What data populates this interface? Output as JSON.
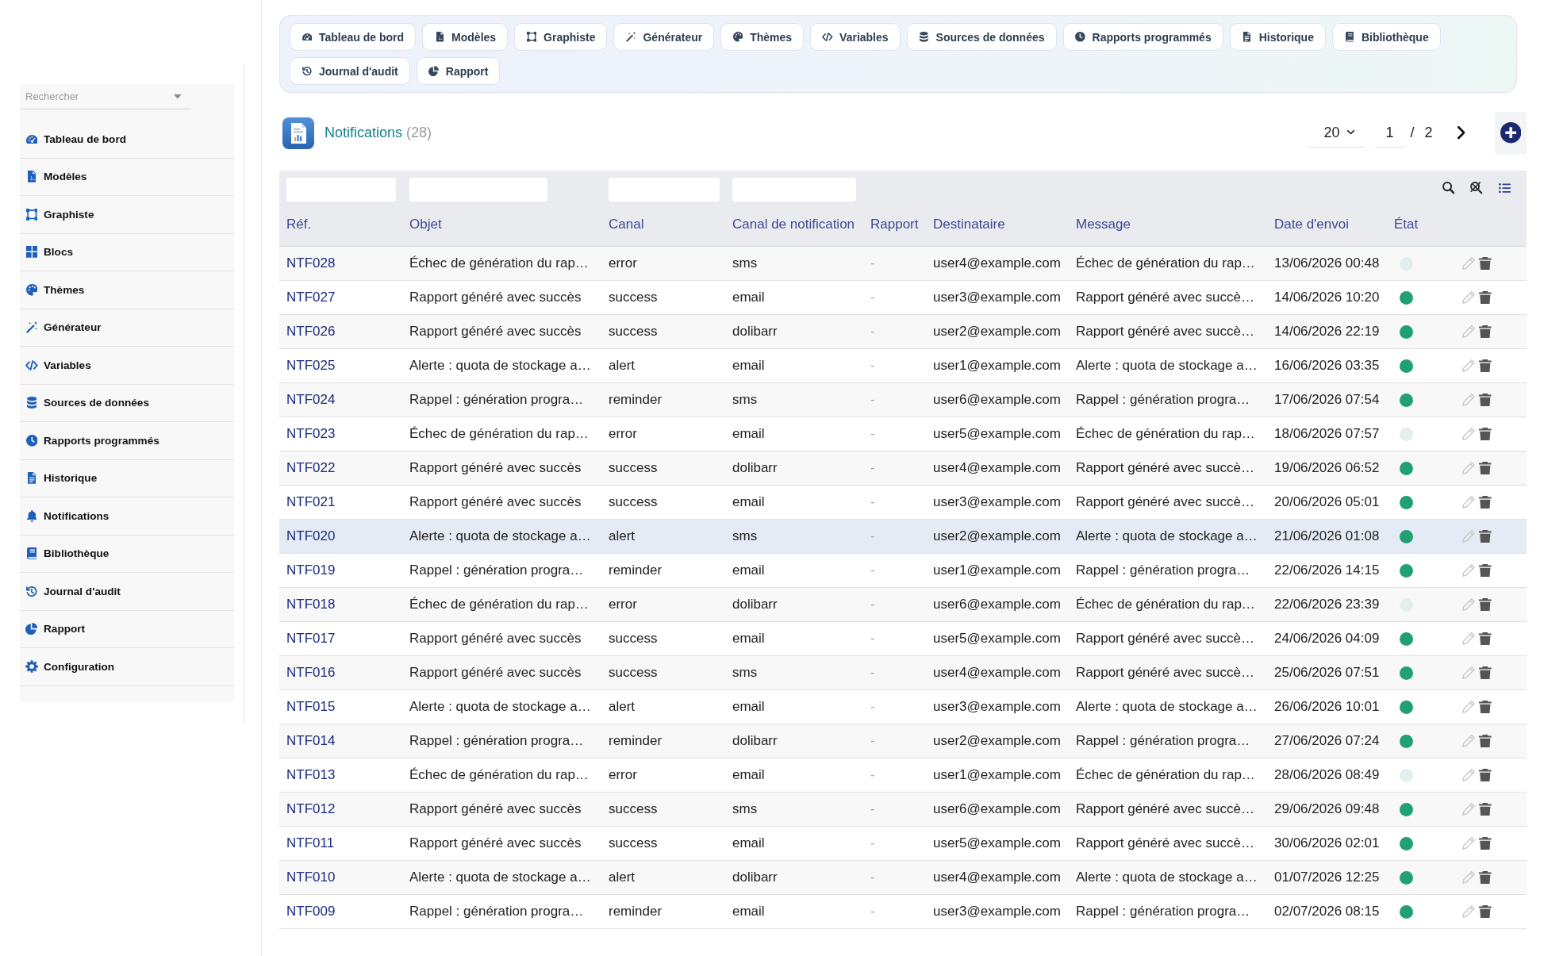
{
  "sidebar": {
    "search": {
      "placeholder": "Rechercher"
    },
    "items": [
      {
        "label": "Tableau de bord"
      },
      {
        "label": "Modèles"
      },
      {
        "label": "Graphiste"
      },
      {
        "label": "Blocs"
      },
      {
        "label": "Thèmes"
      },
      {
        "label": "Générateur"
      },
      {
        "label": "Variables"
      },
      {
        "label": "Sources de données"
      },
      {
        "label": "Rapports programmés"
      },
      {
        "label": "Historique"
      },
      {
        "label": "Notifications"
      },
      {
        "label": "Bibliothèque"
      },
      {
        "label": "Journal d'audit"
      },
      {
        "label": "Rapport"
      },
      {
        "label": "Configuration"
      }
    ]
  },
  "tabs": [
    {
      "label": "Tableau de bord"
    },
    {
      "label": "Modèles"
    },
    {
      "label": "Graphiste"
    },
    {
      "label": "Générateur"
    },
    {
      "label": "Thèmes"
    },
    {
      "label": "Variables"
    },
    {
      "label": "Sources de données"
    },
    {
      "label": "Rapports programmés"
    },
    {
      "label": "Historique"
    },
    {
      "label": "Bibliothèque"
    },
    {
      "label": "Journal d'audit"
    },
    {
      "label": "Rapport"
    }
  ],
  "header": {
    "title": "Notifications",
    "count": "(28)"
  },
  "pagination": {
    "page_size": "20",
    "page": "1",
    "separator": "/",
    "total_pages": "2"
  },
  "table": {
    "columns": [
      {
        "label": "Réf.",
        "filter": true
      },
      {
        "label": "Objet",
        "filter": true
      },
      {
        "label": "Canal",
        "filter": true
      },
      {
        "label": "Canal de notification",
        "filter": true
      },
      {
        "label": "Rapport",
        "filter": false
      },
      {
        "label": "Destinataire",
        "filter": false
      },
      {
        "label": "Message",
        "filter": false
      },
      {
        "label": "Date d'envoi",
        "filter": false
      },
      {
        "label": "État",
        "filter": false
      }
    ],
    "rows": [
      {
        "ref": "NTF028",
        "subject": "Échec de génération du rap…",
        "channel": "error",
        "notification_channel": "sms",
        "report": "-",
        "recipient": "user4@example.com",
        "message": "Échec de génération du rap…",
        "sent_at": "13/06/2026 00:48",
        "color": "#e4eeee",
        "selected": false
      },
      {
        "ref": "NTF027",
        "subject": "Rapport généré avec succès",
        "channel": "success",
        "notification_channel": "email",
        "report": "-",
        "recipient": "user3@example.com",
        "message": "Rapport généré avec succè…",
        "sent_at": "14/06/2026 10:20",
        "color": "#21a073",
        "selected": false
      },
      {
        "ref": "NTF026",
        "subject": "Rapport généré avec succès",
        "channel": "success",
        "notification_channel": "dolibarr",
        "report": "-",
        "recipient": "user2@example.com",
        "message": "Rapport généré avec succè…",
        "sent_at": "14/06/2026 22:19",
        "color": "#21a073",
        "selected": false
      },
      {
        "ref": "NTF025",
        "subject": "Alerte : quota de stockage a…",
        "channel": "alert",
        "notification_channel": "email",
        "report": "-",
        "recipient": "user1@example.com",
        "message": "Alerte : quota de stockage a…",
        "sent_at": "16/06/2026 03:35",
        "color": "#21a073",
        "selected": false
      },
      {
        "ref": "NTF024",
        "subject": "Rappel : génération progra…",
        "channel": "reminder",
        "notification_channel": "sms",
        "report": "-",
        "recipient": "user6@example.com",
        "message": "Rappel : génération progra…",
        "sent_at": "17/06/2026 07:54",
        "color": "#21a073",
        "selected": false
      },
      {
        "ref": "NTF023",
        "subject": "Échec de génération du rap…",
        "channel": "error",
        "notification_channel": "email",
        "report": "-",
        "recipient": "user5@example.com",
        "message": "Échec de génération du rap…",
        "sent_at": "18/06/2026 07:57",
        "color": "#e4eeee",
        "selected": false
      },
      {
        "ref": "NTF022",
        "subject": "Rapport généré avec succès",
        "channel": "success",
        "notification_channel": "dolibarr",
        "report": "-",
        "recipient": "user4@example.com",
        "message": "Rapport généré avec succè…",
        "sent_at": "19/06/2026 06:52",
        "color": "#21a073",
        "selected": false
      },
      {
        "ref": "NTF021",
        "subject": "Rapport généré avec succès",
        "channel": "success",
        "notification_channel": "email",
        "report": "-",
        "recipient": "user3@example.com",
        "message": "Rapport généré avec succè…",
        "sent_at": "20/06/2026 05:01",
        "color": "#21a073",
        "selected": false
      },
      {
        "ref": "NTF020",
        "subject": "Alerte : quota de stockage a…",
        "channel": "alert",
        "notification_channel": "sms",
        "report": "-",
        "recipient": "user2@example.com",
        "message": "Alerte : quota de stockage a…",
        "sent_at": "21/06/2026 01:08",
        "color": "#21a073",
        "selected": true
      },
      {
        "ref": "NTF019",
        "subject": "Rappel : génération progra…",
        "channel": "reminder",
        "notification_channel": "email",
        "report": "-",
        "recipient": "user1@example.com",
        "message": "Rappel : génération progra…",
        "sent_at": "22/06/2026 14:15",
        "color": "#21a073",
        "selected": false
      },
      {
        "ref": "NTF018",
        "subject": "Échec de génération du rap…",
        "channel": "error",
        "notification_channel": "dolibarr",
        "report": "-",
        "recipient": "user6@example.com",
        "message": "Échec de génération du rap…",
        "sent_at": "22/06/2026 23:39",
        "color": "#e4eeee",
        "selected": false
      },
      {
        "ref": "NTF017",
        "subject": "Rapport généré avec succès",
        "channel": "success",
        "notification_channel": "email",
        "report": "-",
        "recipient": "user5@example.com",
        "message": "Rapport généré avec succè…",
        "sent_at": "24/06/2026 04:09",
        "color": "#21a073",
        "selected": false
      },
      {
        "ref": "NTF016",
        "subject": "Rapport généré avec succès",
        "channel": "success",
        "notification_channel": "sms",
        "report": "-",
        "recipient": "user4@example.com",
        "message": "Rapport généré avec succè…",
        "sent_at": "25/06/2026 07:51",
        "color": "#21a073",
        "selected": false
      },
      {
        "ref": "NTF015",
        "subject": "Alerte : quota de stockage a…",
        "channel": "alert",
        "notification_channel": "email",
        "report": "-",
        "recipient": "user3@example.com",
        "message": "Alerte : quota de stockage a…",
        "sent_at": "26/06/2026 10:01",
        "color": "#21a073",
        "selected": false
      },
      {
        "ref": "NTF014",
        "subject": "Rappel : génération progra…",
        "channel": "reminder",
        "notification_channel": "dolibarr",
        "report": "-",
        "recipient": "user2@example.com",
        "message": "Rappel : génération progra…",
        "sent_at": "27/06/2026 07:24",
        "color": "#21a073",
        "selected": false
      },
      {
        "ref": "NTF013",
        "subject": "Échec de génération du rap…",
        "channel": "error",
        "notification_channel": "email",
        "report": "-",
        "recipient": "user1@example.com",
        "message": "Échec de génération du rap…",
        "sent_at": "28/06/2026 08:49",
        "color": "#e4eeee",
        "selected": false
      },
      {
        "ref": "NTF012",
        "subject": "Rapport généré avec succès",
        "channel": "success",
        "notification_channel": "sms",
        "report": "-",
        "recipient": "user6@example.com",
        "message": "Rapport généré avec succè…",
        "sent_at": "29/06/2026 09:48",
        "color": "#21a073",
        "selected": false
      },
      {
        "ref": "NTF011",
        "subject": "Rapport généré avec succès",
        "channel": "success",
        "notification_channel": "email",
        "report": "-",
        "recipient": "user5@example.com",
        "message": "Rapport généré avec succè…",
        "sent_at": "30/06/2026 02:01",
        "color": "#21a073",
        "selected": false
      },
      {
        "ref": "NTF010",
        "subject": "Alerte : quota de stockage a…",
        "channel": "alert",
        "notification_channel": "dolibarr",
        "report": "-",
        "recipient": "user4@example.com",
        "message": "Alerte : quota de stockage a…",
        "sent_at": "01/07/2026 12:25",
        "color": "#21a073",
        "selected": false
      },
      {
        "ref": "NTF009",
        "subject": "Rappel : génération progra…",
        "channel": "reminder",
        "notification_channel": "email",
        "report": "-",
        "recipient": "user3@example.com",
        "message": "Rappel : génération progra…",
        "sent_at": "02/07/2026 08:15",
        "color": "#21a073",
        "selected": false
      }
    ]
  }
}
